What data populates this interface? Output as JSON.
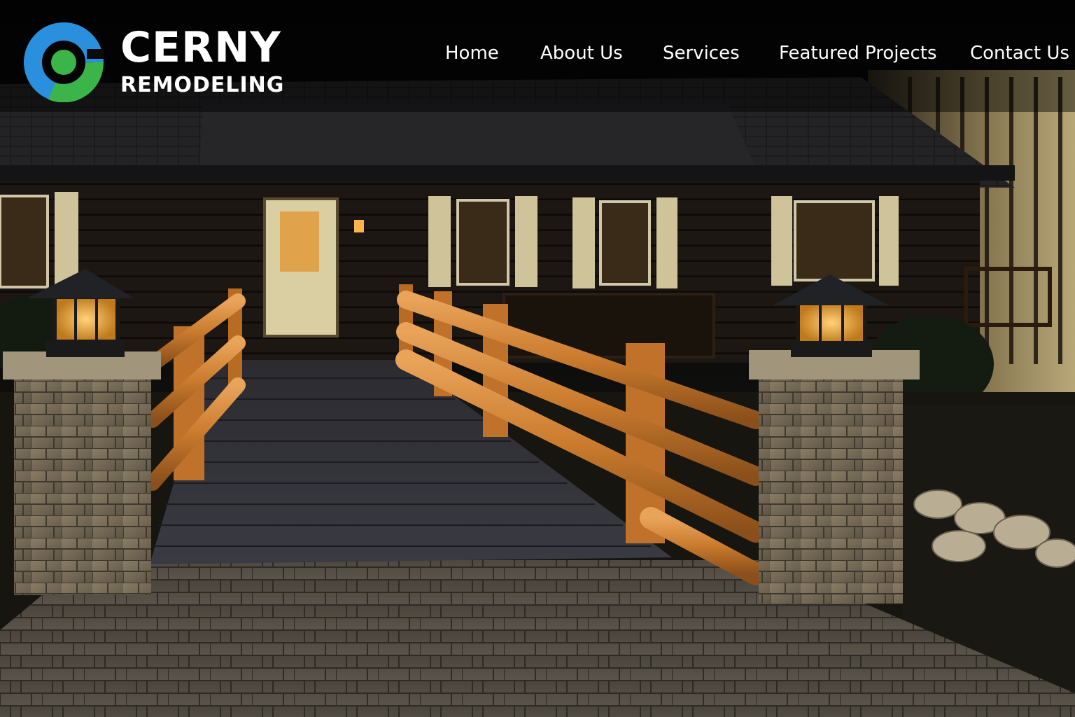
{
  "brand": {
    "name_line1": "CERNY",
    "name_line2": "REMODELING",
    "colors": {
      "blue": "#2a8fdd",
      "green": "#3bb54a",
      "text": "#ffffff"
    }
  },
  "nav": {
    "items": [
      {
        "label": "Home"
      },
      {
        "label": "About Us"
      },
      {
        "label": "Services"
      },
      {
        "label": "Featured Projects"
      },
      {
        "label": "Contact Us"
      }
    ]
  },
  "hero": {
    "icon": "log-cabin-walkway-photo",
    "accent": "#d6893f"
  }
}
